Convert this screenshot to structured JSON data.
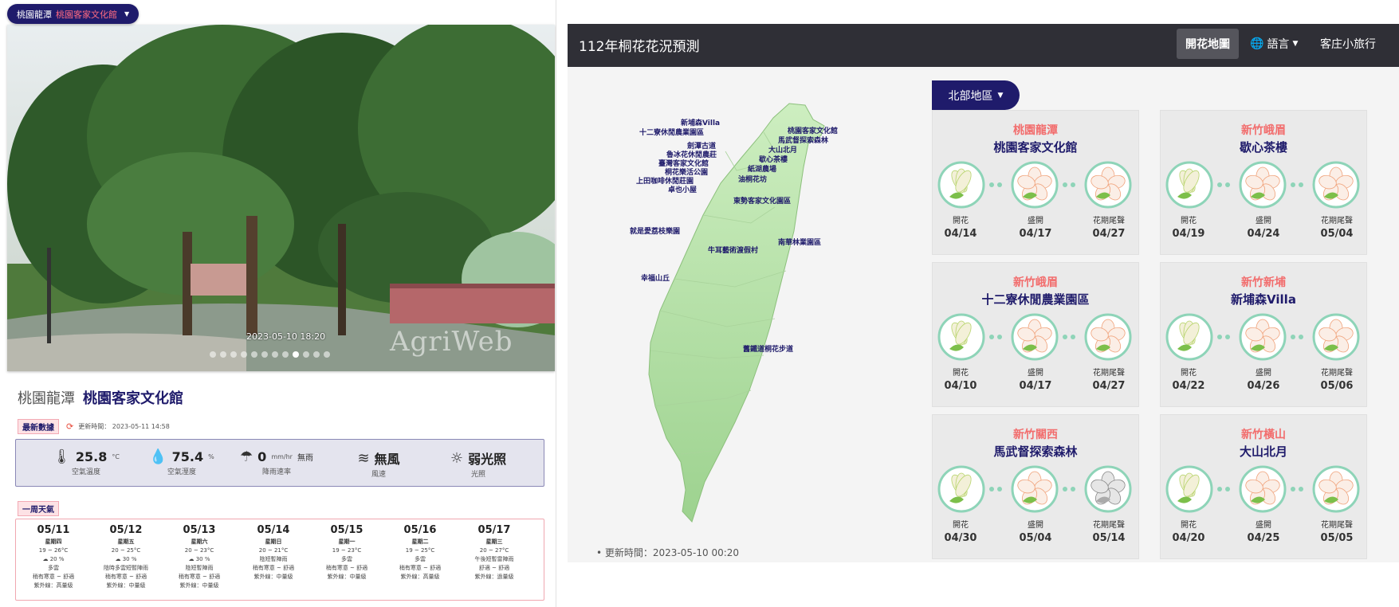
{
  "left": {
    "location_pill": {
      "area": "桃園龍潭",
      "station": "桃園客家文化館"
    },
    "photo": {
      "timestamp": "2023-05-10 18:20",
      "watermark": "AgriWeb",
      "slide_count": 12,
      "active_slide": 9
    },
    "station": {
      "area": "桃園龍潭",
      "name": "桃園客家文化館"
    },
    "latest_tag": "最新數據",
    "update_time": "更新時間： 2023-05-11 14:58",
    "current": [
      {
        "icon": "thermometer-icon",
        "value": "25.8",
        "unit": "°C",
        "label": "空氣溫度"
      },
      {
        "icon": "humidity-icon",
        "value": "75.4",
        "unit": "%",
        "label": "空氣溼度"
      },
      {
        "icon": "rain-icon",
        "value": "0",
        "unit": "mm/hr",
        "extra": "無雨",
        "label": "降雨速率"
      },
      {
        "icon": "wind-icon",
        "value": "無風",
        "unit": "",
        "label": "風速"
      },
      {
        "icon": "sun-icon",
        "value": "弱光照",
        "unit": "",
        "label": "光照"
      }
    ],
    "week_tag": "一周天氣",
    "forecast": [
      {
        "date": "05/11",
        "weekday": "星期四",
        "temp": "19 ~ 26°C",
        "pop": "20 %",
        "desc": "多雲",
        "comfort": "稍有寒意 ~ 舒適",
        "uv": "紫外線：高量級"
      },
      {
        "date": "05/12",
        "weekday": "星期五",
        "temp": "20 ~ 25°C",
        "pop": "30 %",
        "desc": "陰時多雲短暫陣雨",
        "comfort": "稍有寒意 ~ 舒適",
        "uv": "紫外線：中量級"
      },
      {
        "date": "05/13",
        "weekday": "星期六",
        "temp": "20 ~ 23°C",
        "pop": "30 %",
        "desc": "陰短暫陣雨",
        "comfort": "稍有寒意 ~ 舒適",
        "uv": "紫外線：中量級"
      },
      {
        "date": "05/14",
        "weekday": "星期日",
        "temp": "20 ~ 21°C",
        "pop": "",
        "desc": "陰短暫陣雨",
        "comfort": "稍有寒意 ~ 舒適",
        "uv": "紫外線：中量級"
      },
      {
        "date": "05/15",
        "weekday": "星期一",
        "temp": "19 ~ 23°C",
        "pop": "",
        "desc": "多雲",
        "comfort": "稍有寒意 ~ 舒適",
        "uv": "紫外線：中量級"
      },
      {
        "date": "05/16",
        "weekday": "星期二",
        "temp": "19 ~ 25°C",
        "pop": "",
        "desc": "多雲",
        "comfort": "稍有寒意 ~ 舒適",
        "uv": "紫外線：高量級"
      },
      {
        "date": "05/17",
        "weekday": "星期三",
        "temp": "20 ~ 27°C",
        "pop": "",
        "desc": "午後短暫雷陣雨",
        "comfort": "舒適 ~ 舒適",
        "uv": "紫外線：過量級"
      }
    ]
  },
  "right": {
    "brand": "112年桐花花況預測",
    "nav": {
      "map": "開花地圖",
      "language": "語言",
      "trip": "客庄小旅行"
    },
    "region": "北部地區",
    "map_labels": [
      "新埔森Villa",
      "十二寮休閒農業園區",
      "桃園客家文化館",
      "馬武督探索森林",
      "劍潭古道",
      "魯冰花休閒農莊",
      "大山北月",
      "臺灣客家文化館",
      "歇心茶樓",
      "桐花樂活公園",
      "紙湖農場",
      "上田咖啡休閒莊園",
      "油桐花坊",
      "卓也小屋",
      "東勢客家文化園區",
      "就是愛荔枝樂園",
      "南華林業園區",
      "牛耳藝術渡假村",
      "幸福山丘",
      "舊鐵道桐花步道"
    ],
    "update_time": "更新時間：2023-05-10 00:20",
    "stage_labels": [
      "開花",
      "盛開",
      "花期尾聲"
    ],
    "cards": [
      {
        "location": "桃園龍潭",
        "title": "桃園客家文化館",
        "dates": [
          "04/14",
          "04/17",
          "04/27"
        ]
      },
      {
        "location": "新竹峨眉",
        "title": "歇心茶樓",
        "dates": [
          "04/19",
          "04/24",
          "05/04"
        ]
      },
      {
        "location": "新竹峨眉",
        "title": "十二寮休閒農業園區",
        "dates": [
          "04/10",
          "04/17",
          "04/27"
        ]
      },
      {
        "location": "新竹新埔",
        "title": "新埔森Villa",
        "dates": [
          "04/22",
          "04/26",
          "05/06"
        ]
      },
      {
        "location": "新竹關西",
        "title": "馬武督探索森林",
        "dates": [
          "04/30",
          "05/04",
          "05/14"
        ]
      },
      {
        "location": "新竹橫山",
        "title": "大山北月",
        "dates": [
          "04/20",
          "04/25",
          "05/05"
        ]
      }
    ]
  }
}
